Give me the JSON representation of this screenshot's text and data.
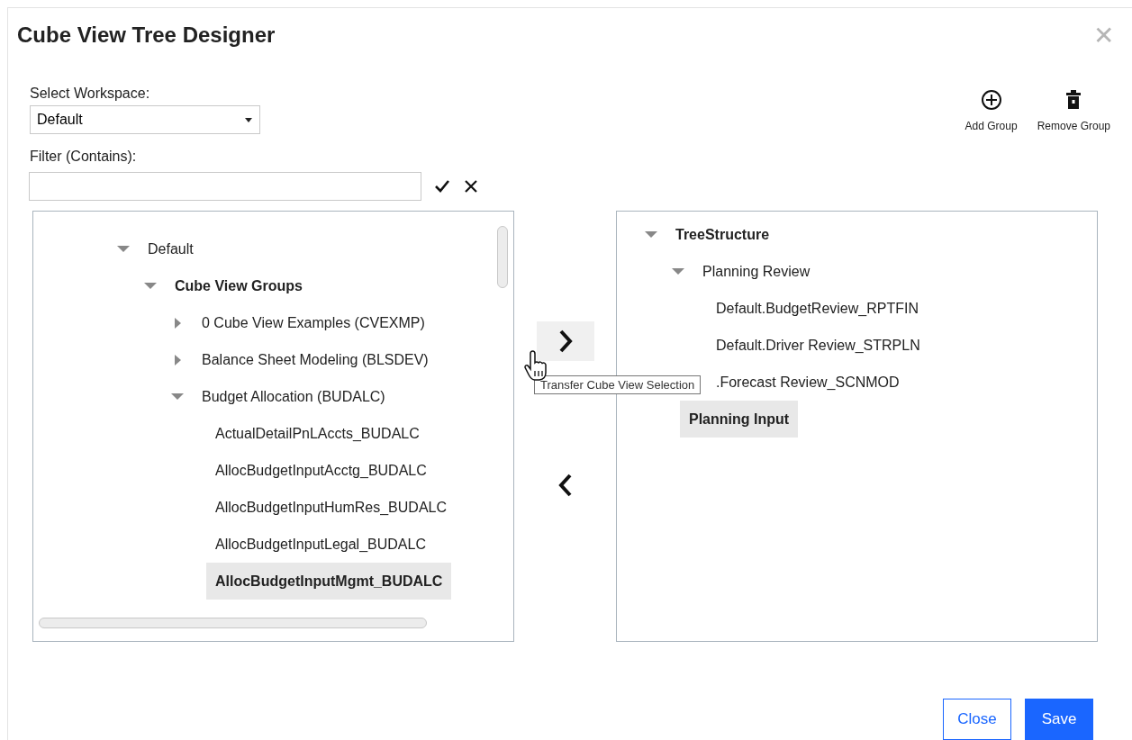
{
  "window": {
    "title": "Cube View Tree Designer",
    "close": "✕"
  },
  "workspace": {
    "label": "Select Workspace:",
    "value": "Default"
  },
  "filter": {
    "label": "Filter (Contains):"
  },
  "toolbar": [
    {
      "kind": "add",
      "label": "Add Group"
    },
    {
      "kind": "remove",
      "label": "Remove Group"
    }
  ],
  "source_tree": [
    {
      "label": "Default",
      "kind": "node",
      "expanded": true,
      "selected": false,
      "children": [
        {
          "label": "Cube View Groups",
          "kind": "category",
          "expanded": true,
          "selected": false,
          "children": [
            {
              "label": "0 Cube View Examples (CVEXMP)",
              "kind": "node",
              "expanded": false,
              "selected": false
            },
            {
              "label": "Balance Sheet Modeling (BLSDEV)",
              "kind": "node",
              "expanded": false,
              "selected": false
            },
            {
              "label": "Budget Allocation (BUDALC)",
              "kind": "node",
              "expanded": true,
              "selected": false,
              "children": [
                {
                  "label": "ActualDetailPnLAccts_BUDALC",
                  "kind": "leaf",
                  "selected": false
                },
                {
                  "label": "AllocBudgetInputAcctg_BUDALC",
                  "kind": "leaf",
                  "selected": false
                },
                {
                  "label": "AllocBudgetInputHumRes_BUDALC",
                  "kind": "leaf",
                  "selected": false
                },
                {
                  "label": "AllocBudgetInputLegal_BUDALC",
                  "kind": "leaf",
                  "selected": false
                },
                {
                  "label": "AllocBudgetInputMgmt_BUDALC",
                  "kind": "leaf",
                  "selected": true
                }
              ]
            }
          ]
        }
      ]
    }
  ],
  "transfer": {
    "tooltip": "Transfer Cube View Selection"
  },
  "target_tree": [
    {
      "label": "TreeStructure",
      "kind": "category",
      "expanded": true,
      "selected": false,
      "children": [
        {
          "label": "Planning Review",
          "kind": "node",
          "expanded": true,
          "selected": false,
          "children": [
            {
              "label": "Default.BudgetReview_RPTFIN",
              "kind": "leaf",
              "selected": false
            },
            {
              "label": "Default.Driver Review_STRPLN",
              "kind": "leaf",
              "selected": false
            },
            {
              "label": ".Forecast Review_SCNMOD",
              "kind": "leaf",
              "selected": false
            }
          ]
        },
        {
          "label": "Planning Input",
          "kind": "leaf",
          "selected": true
        }
      ]
    }
  ],
  "buttons": [
    {
      "kind": "secondary",
      "label": "Close"
    },
    {
      "kind": "primary",
      "label": "Save"
    }
  ]
}
